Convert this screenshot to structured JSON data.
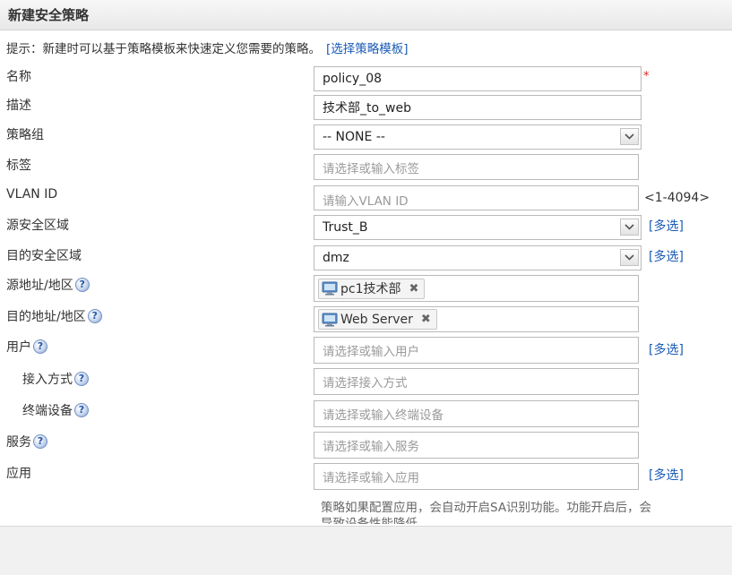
{
  "dialog": {
    "title": "新建安全策略"
  },
  "hint": {
    "text": "提示：新建时可以基于策略模板来快速定义您需要的策略。",
    "link": "[选择策略模板]"
  },
  "form": {
    "name": {
      "label": "名称",
      "value": "policy_08",
      "required_mark": "*"
    },
    "description": {
      "label": "描述",
      "value": "技术部_to_web"
    },
    "policy_group": {
      "label": "策略组",
      "value": "-- NONE --"
    },
    "tags": {
      "label": "标签",
      "placeholder": "请选择或输入标签"
    },
    "vlan_id": {
      "label": "VLAN ID",
      "placeholder": "请输入VLAN ID",
      "range": "<1-4094>"
    },
    "src_zone": {
      "label": "源安全区域",
      "value": "Trust_B",
      "multi": "[多选]"
    },
    "dst_zone": {
      "label": "目的安全区域",
      "value": "dmz",
      "multi": "[多选]"
    },
    "src_addr": {
      "label": "源地址/地区",
      "chip": "pc1技术部"
    },
    "dst_addr": {
      "label": "目的地址/地区",
      "chip": "Web Server"
    },
    "user": {
      "label": "用户",
      "placeholder": "请选择或输入用户",
      "multi": "[多选]"
    },
    "access_mode": {
      "label": "接入方式",
      "placeholder": "请选择接入方式"
    },
    "terminal": {
      "label": "终端设备",
      "placeholder": "请选择或输入终端设备"
    },
    "service": {
      "label": "服务",
      "placeholder": "请选择或输入服务"
    },
    "application": {
      "label": "应用",
      "placeholder": "请选择或输入应用",
      "multi": "[多选]"
    },
    "app_note": "策略如果配置应用，会自动开启SA识别功能。功能开启后，会导致设备性能降低。"
  },
  "colors": {
    "link": "#1a5bb5",
    "required": "#dd2222",
    "title_bar": "#ececec"
  },
  "icons": {
    "help": "question-circle-icon",
    "select": "chevron-down-icon",
    "address": "computer-icon",
    "remove": "close-icon"
  },
  "help_glyph": "?",
  "remove_glyph": "✖"
}
